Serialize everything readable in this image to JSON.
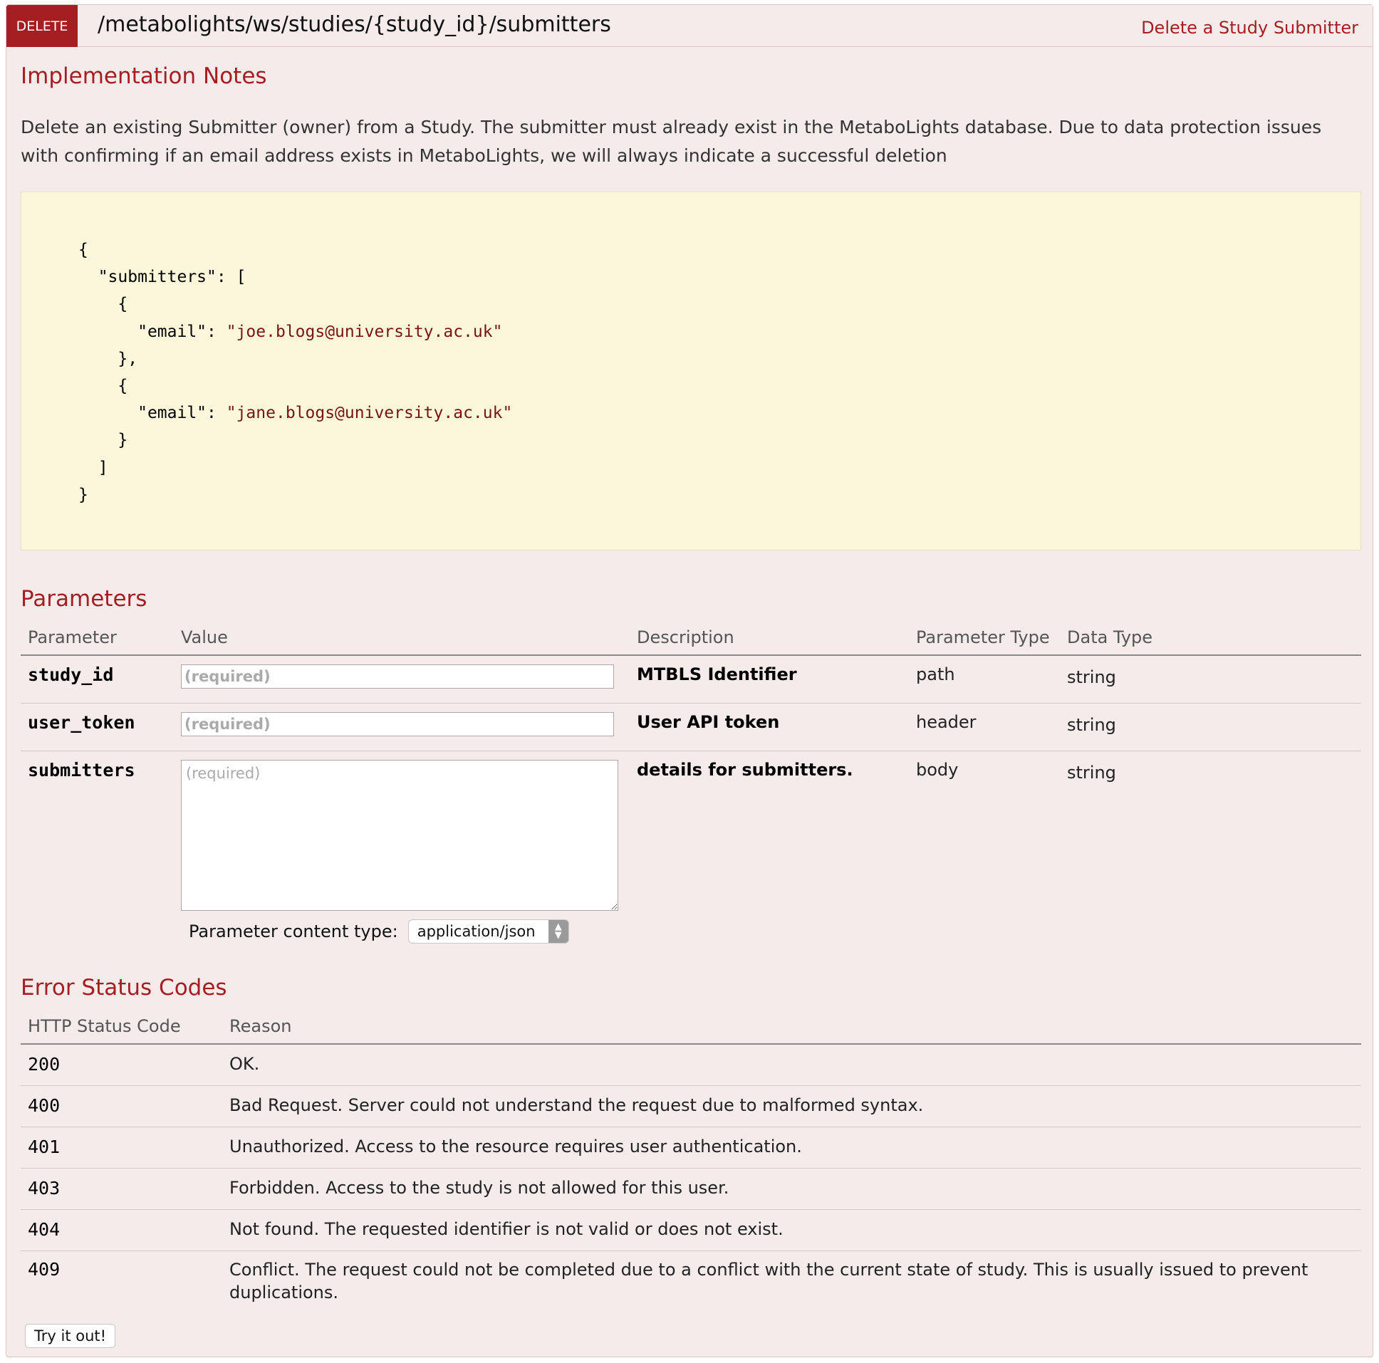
{
  "operation": {
    "method": "DELETE",
    "path": "/metabolights/ws/studies/{study_id}/submitters",
    "summary": "Delete a Study Submitter"
  },
  "implementation_notes": {
    "title": "Implementation Notes",
    "text": "Delete an existing Submitter (owner) from a Study. The submitter must already exist in the MetaboLights database. Due to data protection issues with confirming if an email address exists in MetaboLights, we will always indicate a successful deletion",
    "example": {
      "key_submitters": "\"submitters\"",
      "key_email": "\"email\"",
      "emails": [
        "\"joe.blogs@university.ac.uk\"",
        "\"jane.blogs@university.ac.uk\""
      ]
    }
  },
  "parameters": {
    "title": "Parameters",
    "headers": [
      "Parameter",
      "Value",
      "Description",
      "Parameter Type",
      "Data Type"
    ],
    "rows": [
      {
        "name": "study_id",
        "placeholder": "(required)",
        "description": "MTBLS Identifier",
        "param_type": "path",
        "data_type": "string"
      },
      {
        "name": "user_token",
        "placeholder": "(required)",
        "description": "User API token",
        "param_type": "header",
        "data_type": "string"
      },
      {
        "name": "submitters",
        "placeholder": "(required)",
        "description": "details for submitters.",
        "param_type": "body",
        "data_type": "string"
      }
    ],
    "content_type_label": "Parameter content type:",
    "content_type_value": "application/json"
  },
  "errors": {
    "title": "Error Status Codes",
    "headers": [
      "HTTP Status Code",
      "Reason"
    ],
    "rows": [
      {
        "code": "200",
        "reason": "OK."
      },
      {
        "code": "400",
        "reason": "Bad Request. Server could not understand the request due to malformed syntax."
      },
      {
        "code": "401",
        "reason": "Unauthorized. Access to the resource requires user authentication."
      },
      {
        "code": "403",
        "reason": "Forbidden. Access to the study is not allowed for this user."
      },
      {
        "code": "404",
        "reason": "Not found. The requested identifier is not valid or does not exist."
      },
      {
        "code": "409",
        "reason": "Conflict. The request could not be completed due to a conflict with the current state of study. This is usually issued to prevent duplications."
      }
    ]
  },
  "try_button": "Try it out!",
  "colors": {
    "accent": "#a41e22",
    "panel_bg": "#f5ebeb",
    "code_bg": "#fcf6db"
  }
}
